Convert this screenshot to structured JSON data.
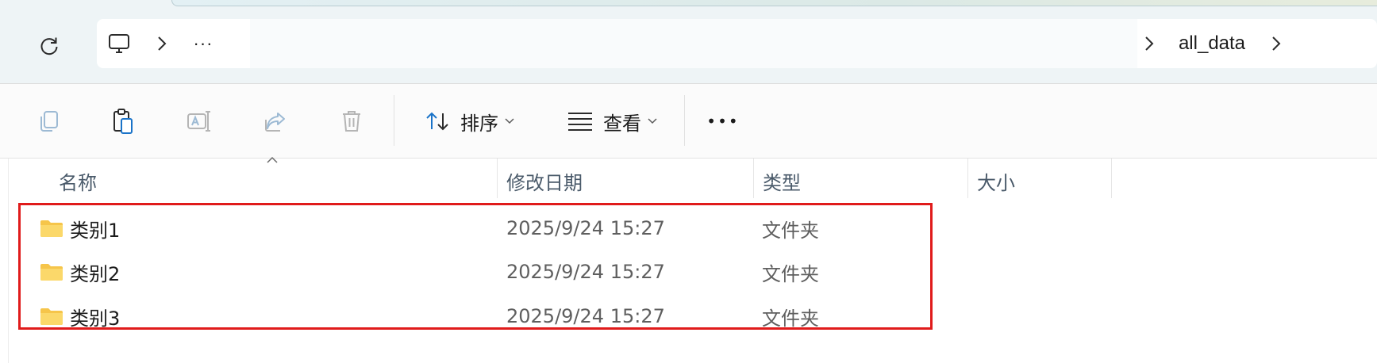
{
  "address_bar": {
    "crumb_icon": "computer-icon",
    "overflow_label": "···",
    "current_folder": "all_data"
  },
  "command_bar": {
    "sort_label": "排序",
    "view_label": "查看",
    "more_label": "•••"
  },
  "columns": {
    "name": "名称",
    "modified": "修改日期",
    "type": "类型",
    "size": "大小"
  },
  "files": [
    {
      "name": "类别1",
      "modified": "2025/9/24 15:27",
      "type": "文件夹"
    },
    {
      "name": "类别2",
      "modified": "2025/9/24 15:27",
      "type": "文件夹"
    },
    {
      "name": "类别3",
      "modified": "2025/9/24 15:27",
      "type": "文件夹"
    }
  ],
  "colors": {
    "selection_outline": "#e01b1b",
    "folder_fill": "#f6c54a",
    "accent_blue": "#1a73c8"
  }
}
